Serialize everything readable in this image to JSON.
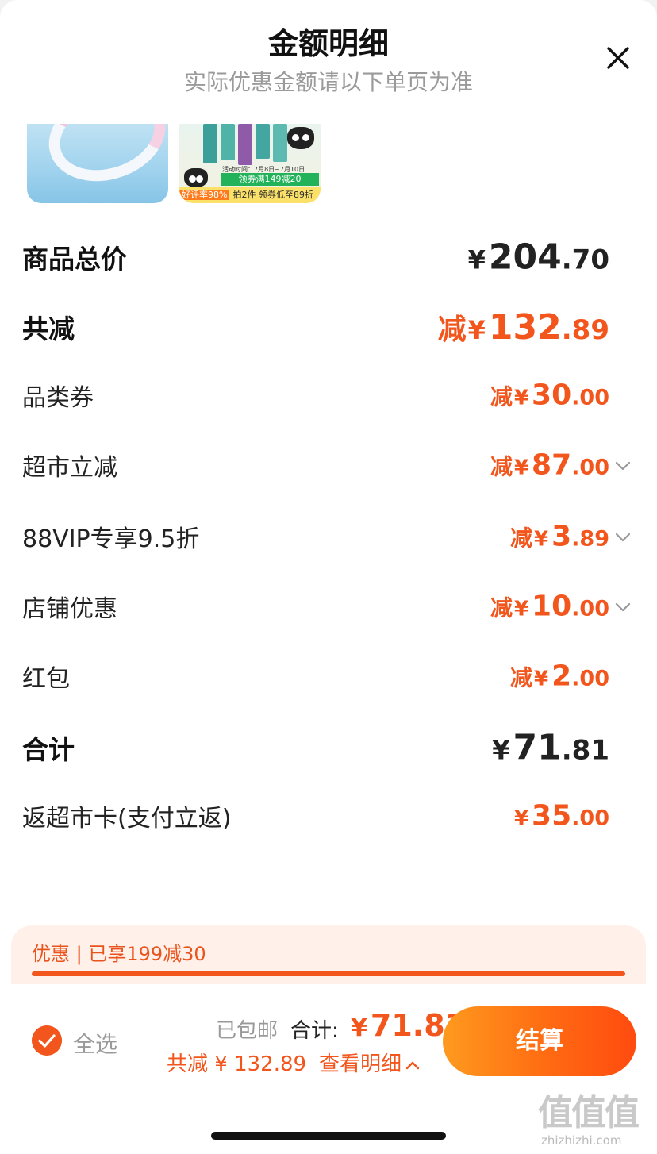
{
  "header": {
    "title": "金额明细",
    "subtitle": "实际优惠金额请以下单页为准",
    "close_icon": "close-icon"
  },
  "thumbnails": {
    "item2_date": "活动时间：7月8日~7月10日",
    "item2_coupon": "领券满149减20",
    "item2_rating": "好评率98%",
    "item2_promo": "拍2件 领券低至89折",
    "item2_badge": "拍2件"
  },
  "rows": [
    {
      "label": "商品总价",
      "prefix": "",
      "yen": "¥",
      "int": "204",
      "dec": ".70",
      "style": "strong-dark"
    },
    {
      "label": "共减",
      "prefix": "减",
      "yen": "¥",
      "int": "132",
      "dec": ".89",
      "style": "strong-orange"
    },
    {
      "label": "品类券",
      "prefix": "减",
      "yen": "¥",
      "int": "30",
      "dec": ".00",
      "style": "orange"
    },
    {
      "label": "超市立减",
      "prefix": "减",
      "yen": "¥",
      "int": "87",
      "dec": ".00",
      "style": "orange",
      "expandable": true
    },
    {
      "label": "88VIP专享9.5折",
      "prefix": "减",
      "yen": "¥",
      "int": "3",
      "dec": ".89",
      "style": "orange",
      "expandable": true
    },
    {
      "label": "店铺优惠",
      "prefix": "减",
      "yen": "¥",
      "int": "10",
      "dec": ".00",
      "style": "orange",
      "expandable": true
    },
    {
      "label": "红包",
      "prefix": "减",
      "yen": "¥",
      "int": "2",
      "dec": ".00",
      "style": "orange"
    },
    {
      "label": "合计",
      "prefix": "",
      "yen": "¥",
      "int": "71",
      "dec": ".81",
      "style": "strong-dark"
    },
    {
      "label": "返超市卡(支付立返)",
      "prefix": "",
      "yen": "¥",
      "int": "35",
      "dec": ".00",
      "style": "orange"
    }
  ],
  "promo": {
    "text": "优惠 | 已享199减30"
  },
  "bottom_bar": {
    "select_all": "全选",
    "shipping": "已包邮",
    "total_label": "合计:",
    "total_yen": "¥",
    "total_value": "71.81",
    "savings": "共减 ¥ 132.89",
    "detail_link": "查看明细",
    "checkout": "结算"
  },
  "watermark": {
    "glyphs": "值值值",
    "site": "zhizhizhi.com"
  },
  "colors": {
    "accent": "#f2561d",
    "checkout_gradient_start": "#ff9a1e",
    "checkout_gradient_end": "#ff4b10",
    "promo_bg": "#fff0e9"
  }
}
